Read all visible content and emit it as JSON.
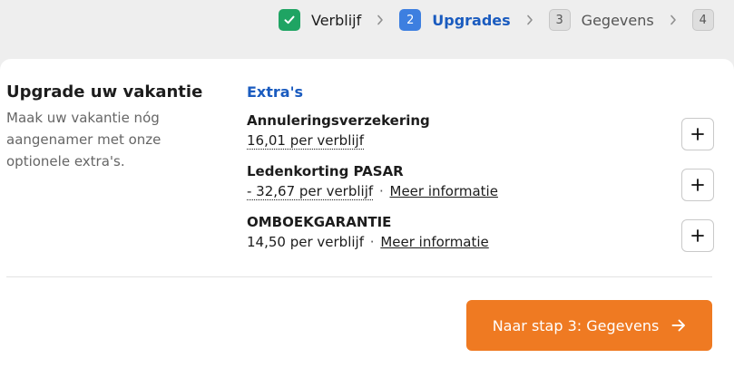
{
  "stepper": {
    "steps": [
      {
        "number": "✓",
        "label": "Verblijf",
        "state": "done"
      },
      {
        "number": "2",
        "label": "Upgrades",
        "state": "active"
      },
      {
        "number": "3",
        "label": "Gegevens",
        "state": "todo"
      },
      {
        "number": "4",
        "label": "",
        "state": "todo"
      }
    ],
    "separator_icon": "chevron-right-icon"
  },
  "intro": {
    "title": "Upgrade uw vakantie",
    "text": "Maak uw vakantie nóg aangenamer met onze optionele extra's."
  },
  "extras": {
    "heading": "Extra's",
    "items": [
      {
        "name": "Annuleringsverzekering",
        "price": "16,01 per verblijf",
        "separator": "",
        "link": ""
      },
      {
        "name": "Ledenkorting PASAR",
        "price": "- 32,67 per verblijf",
        "separator": "·",
        "link": "Meer informatie"
      },
      {
        "name": "OMBOEKGARANTIE",
        "price": "14,50 per verblijf",
        "separator": "·",
        "link": "Meer informatie"
      }
    ],
    "add_icon": "plus-icon"
  },
  "next_button": {
    "label": "Naar stap 3: Gegevens",
    "icon": "arrow-right-icon"
  },
  "colors": {
    "done": "#1fa463",
    "active": "#3d7fe0",
    "active_text": "#1a5bbf",
    "cta": "#ef7a22"
  }
}
